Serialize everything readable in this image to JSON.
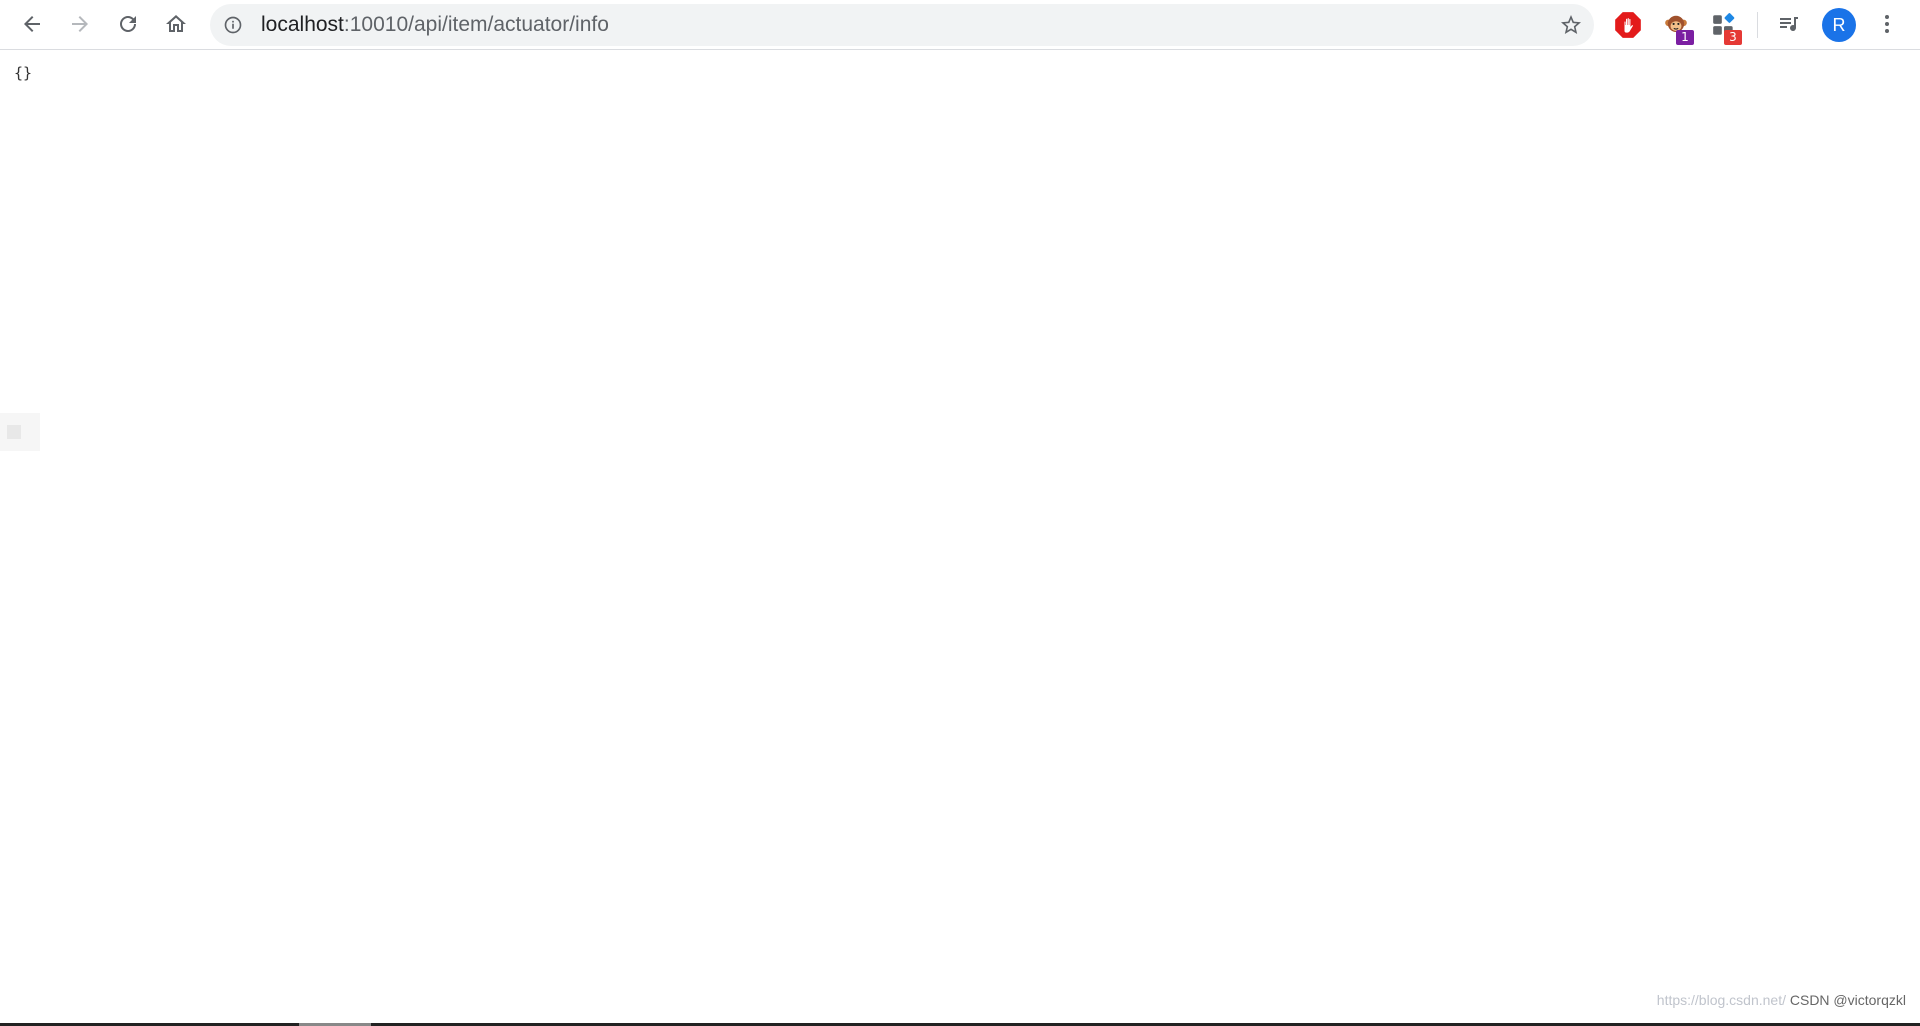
{
  "browser": {
    "nav": {
      "back_icon": "arrow-left-icon",
      "forward_icon": "arrow-right-icon",
      "reload_icon": "reload-icon",
      "home_icon": "home-icon"
    },
    "omnibox": {
      "info_icon": "info-circle-icon",
      "url_host": "localhost",
      "url_rest": ":10010/api/item/actuator/info",
      "bookmark_icon": "star-outline-icon"
    },
    "extensions": [
      {
        "name": "adblock-extension",
        "icon": "hand-stop-icon",
        "color": "#e31b1b",
        "badge": ""
      },
      {
        "name": "tampermonkey-extension",
        "icon": "monkey-icon",
        "color": "#8b1a8b",
        "badge": "1",
        "badge_color": "#7b1fa2"
      },
      {
        "name": "puzzle-extension",
        "icon": "blocks-icon",
        "color": "#1e88e5",
        "badge": "3",
        "badge_color": "#e53935"
      }
    ],
    "media_icon": "media-queue-icon",
    "profile": {
      "initial": "R",
      "color": "#1a73e8"
    },
    "menu_icon": "kebab-menu-icon"
  },
  "page": {
    "body_text": "{}"
  },
  "watermark": {
    "url_text": "https://blog.csdn.net/",
    "csdn_text": "CSDN @victorqzkl"
  }
}
